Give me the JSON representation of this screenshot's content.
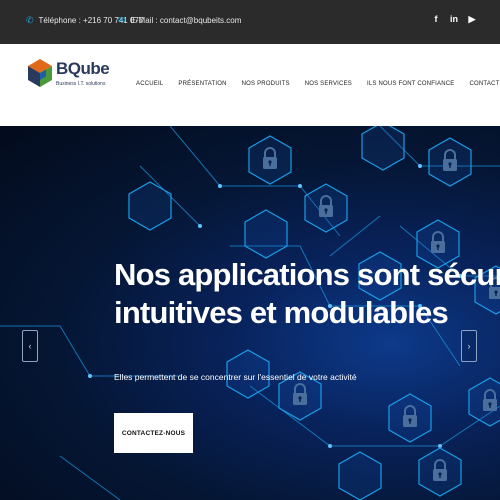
{
  "topbar": {
    "phone": "Téléphone : +216 70 741 077",
    "email": "E-Mail : contact@bqubeits.com",
    "phone_icon": "phone-icon",
    "email_icon": "mail-icon",
    "social": [
      {
        "name": "facebook-icon",
        "glyph": "f"
      },
      {
        "name": "linkedin-icon",
        "glyph": "in"
      },
      {
        "name": "youtube-icon",
        "glyph": "▶"
      }
    ]
  },
  "logo": {
    "name": "BQube",
    "tagline": "Business I.T. solutions",
    "colors": {
      "orange": "#e06a1b",
      "green": "#4a9a3a",
      "navy": "#2b3a5c",
      "blue": "#1f5fa8"
    }
  },
  "nav": {
    "items": [
      "ACCUEIL",
      "PRÉSENTATION",
      "NOS PRODUITS",
      "NOS SERVICES",
      "ILS NOUS FONT CONFIANCE",
      "CONTACT"
    ]
  },
  "hero": {
    "title_line1": "Nos applications sont sécurisées,",
    "title_line2": "intuitives et modulables",
    "subtitle": "Elles permettent de se concentrer sur l'essentiel de votre activité",
    "cta": "CONTACTEZ-NOUS",
    "prev_glyph": "‹",
    "next_glyph": "›",
    "background_icon": "lock-icon",
    "accent": "#1a9be6"
  }
}
